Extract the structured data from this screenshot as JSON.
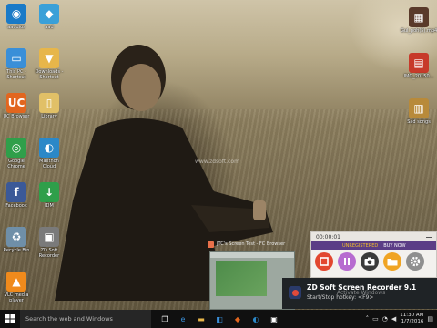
{
  "desktop": {
    "icons_left": [
      {
        "label": "aaudios",
        "glyph": "◉",
        "color": "#1a7ac7"
      },
      {
        "label": "This PC -\nShortcut",
        "glyph": "▭",
        "color": "#3a8fd8"
      },
      {
        "label": "UC Browser",
        "glyph": "UC",
        "color": "#e2661f"
      },
      {
        "label": "Google\nChrome",
        "glyph": "◎",
        "color": "#2f9f4a"
      },
      {
        "label": "Facebook",
        "glyph": "f",
        "color": "#3b5998"
      },
      {
        "label": "Recycle Bin",
        "glyph": "♻",
        "color": "#6f8fa8"
      },
      {
        "label": "VLC media\nplayer",
        "glyph": "▲",
        "color": "#f08a1c"
      }
    ],
    "icons_col2": [
      {
        "label": "aad",
        "glyph": "◆",
        "color": "#3aa0d8"
      },
      {
        "label": "Downloads -\nShortcut",
        "glyph": "▼",
        "color": "#e7b64a"
      },
      {
        "label": "Library",
        "glyph": "▯",
        "color": "#e1c067"
      },
      {
        "label": "Maxthon\nCloud",
        "glyph": "◐",
        "color": "#2b88c8"
      },
      {
        "label": "IDM",
        "glyph": "↓",
        "color": "#2f9f4a"
      },
      {
        "label": "ZD Soft\nRecorder",
        "glyph": "▣",
        "color": "#7a7a7a"
      }
    ],
    "icons_right": [
      {
        "label": "Gul_poh(5).mp4",
        "glyph": "▦",
        "color": "#5a3a2a"
      },
      {
        "label": "IMG_20150...",
        "glyph": "▤",
        "color": "#c73a2a"
      },
      {
        "label": "Sad songs",
        "glyph": "▥",
        "color": "#b88a3a"
      }
    ],
    "watermark": "www.zdsoft.com",
    "activate_windows": "Activate Windows"
  },
  "preview_window": {
    "title": "JTC's Screen Test - FC Browser"
  },
  "recorder": {
    "time": "00:00:01",
    "unregistered": "UNREGISTERED",
    "buy_now": "BUY NOW",
    "buttons": [
      "stop",
      "pause",
      "camera",
      "folder",
      "settings"
    ]
  },
  "toast": {
    "title": "ZD Soft Screen Recorder 9.1",
    "message": "Start/Stop hotkey: <F9>"
  },
  "taskbar": {
    "search_placeholder": "Search the web and Windows",
    "time": "11:30 AM",
    "date": "1/7/2016"
  }
}
